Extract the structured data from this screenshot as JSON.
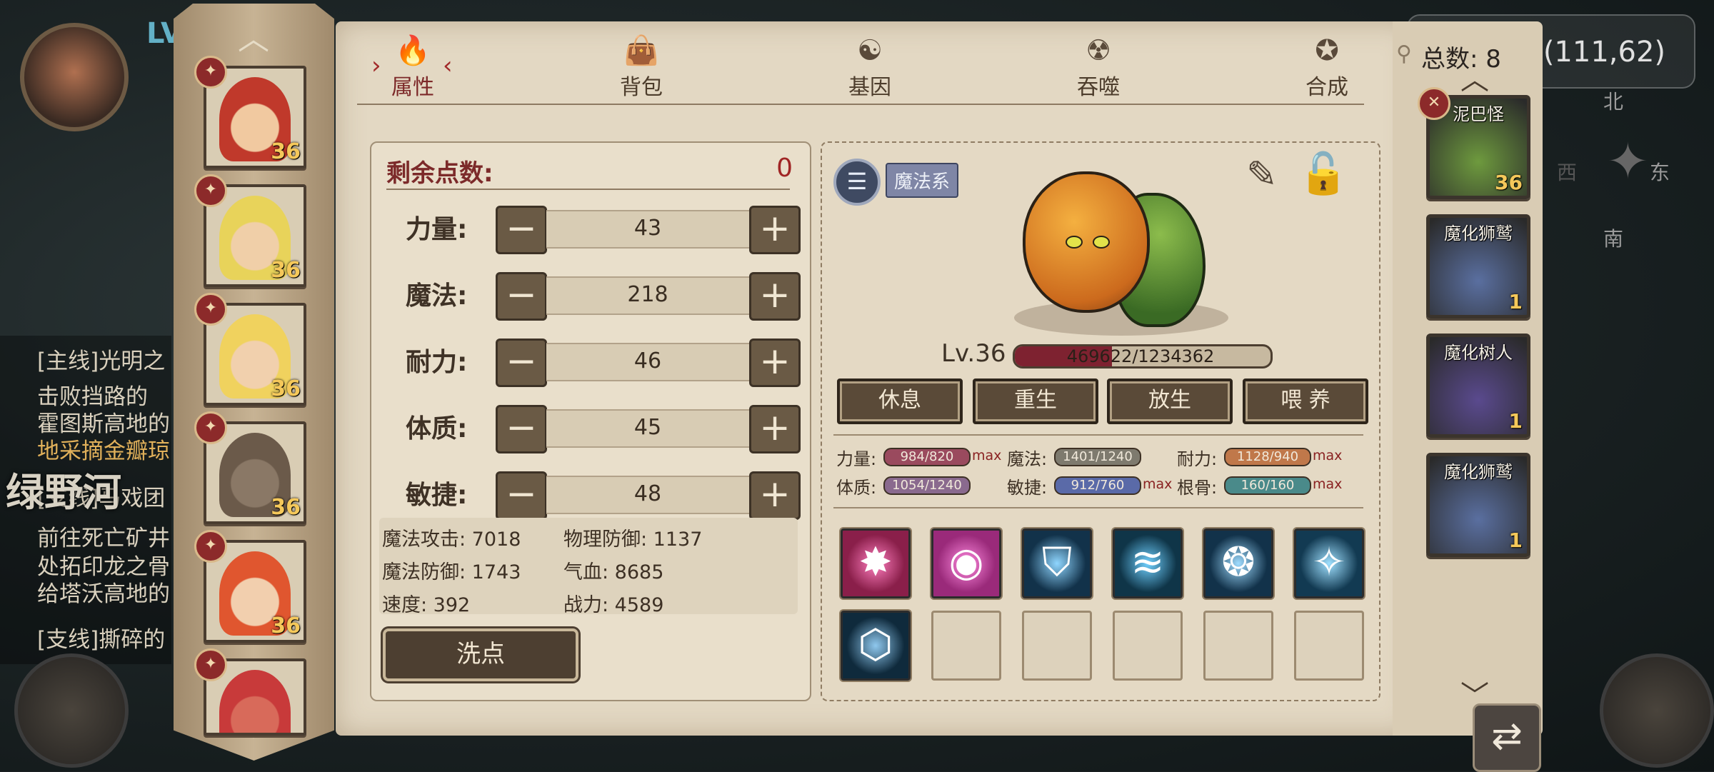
{
  "background": {
    "player_level": "LV",
    "coordinates": "(111,62)",
    "compass": {
      "north": "北",
      "south": "南",
      "west": "西",
      "east": "东"
    },
    "river_label": "绿野河",
    "quests": [
      {
        "text": "[主线]光明之",
        "highlight": false
      },
      {
        "text": "击败挡路的",
        "highlight": false
      },
      {
        "text": "霍图斯高地的",
        "highlight": false
      },
      {
        "text": "地采摘金瓣琼",
        "highlight": true
      },
      {
        "text": "[支线]马戏团",
        "highlight": false
      },
      {
        "text": "前往死亡矿井",
        "highlight": false
      },
      {
        "text": "处拓印龙之骨",
        "highlight": false
      },
      {
        "text": "给塔沃高地的",
        "highlight": false
      },
      {
        "text": "[支线]撕碎的",
        "highlight": false
      }
    ]
  },
  "characters": [
    {
      "level": "36",
      "hair": "#c0392b",
      "skin": "#f1c9a0"
    },
    {
      "level": "36",
      "hair": "#e8d35a",
      "skin": "#f0cfa8"
    },
    {
      "level": "36",
      "hair": "#f0d25e",
      "skin": "#f1d0ad"
    },
    {
      "level": "36",
      "hair": "#6b5a4a",
      "skin": "#8a7866"
    },
    {
      "level": "36",
      "hair": "#e0562f",
      "skin": "#f2cfae"
    },
    {
      "level": "",
      "hair": "#c83a3a",
      "skin": "#d86a5a"
    }
  ],
  "tabs": [
    {
      "label": "属性",
      "icon": "fire-icon",
      "glyph": "🔥",
      "active": true
    },
    {
      "label": "背包",
      "icon": "bag-icon",
      "glyph": "👜",
      "active": false
    },
    {
      "label": "基因",
      "icon": "gene-icon",
      "glyph": "☯",
      "active": false
    },
    {
      "label": "吞噬",
      "icon": "devour-icon",
      "glyph": "☢",
      "active": false
    },
    {
      "label": "合成",
      "icon": "synth-icon",
      "glyph": "✪",
      "active": false
    }
  ],
  "stats": {
    "remain_label": "剩余点数:",
    "remain_value": "0",
    "rows": [
      {
        "label": "力量:",
        "value": "43"
      },
      {
        "label": "魔法:",
        "value": "218"
      },
      {
        "label": "耐力:",
        "value": "46"
      },
      {
        "label": "体质:",
        "value": "45"
      },
      {
        "label": "敏捷:",
        "value": "48"
      }
    ],
    "minus": "−",
    "plus": "+",
    "derived": [
      {
        "text": "魔法攻击: 7018"
      },
      {
        "text": "物理防御: 1137"
      },
      {
        "text": "魔法防御: 1743"
      },
      {
        "text": "气血: 8685"
      },
      {
        "text": "速度: 392"
      },
      {
        "text": "战力: 4589"
      }
    ],
    "reset_label": "洗点"
  },
  "pet": {
    "type_tag": "魔法系",
    "level": "Lv.36",
    "hp_text": "469622/1234362",
    "hp_fraction": 0.38,
    "actions": [
      "休息",
      "重生",
      "放生",
      "喂 养"
    ],
    "attributes": [
      {
        "label": "力量:",
        "value": "984/820",
        "color": "#9a4a5e",
        "max": "max"
      },
      {
        "label": "魔法:",
        "value": "1401/1240",
        "color": "#7e7a6e",
        "max": ""
      },
      {
        "label": "耐力:",
        "value": "1128/940",
        "color": "#c0784a",
        "max": "max"
      },
      {
        "label": "体质:",
        "value": "1054/1240",
        "color": "#8a6a8e",
        "max": ""
      },
      {
        "label": "敏捷:",
        "value": "912/760",
        "color": "#5a6aa8",
        "max": "max"
      },
      {
        "label": "根骨:",
        "value": "160/160",
        "color": "#4a8a8a",
        "max": "max"
      }
    ],
    "skills": [
      {
        "icon": "burst-skill-icon",
        "bg": "#8a1f4a",
        "fg": "#ff7fc0",
        "glyph": "✸"
      },
      {
        "icon": "orb-skill-icon",
        "bg": "#9a2a7a",
        "fg": "#ff8ae0",
        "glyph": "◉"
      },
      {
        "icon": "shield-skill-icon",
        "bg": "#12324a",
        "fg": "#8fd6ff",
        "glyph": "⛉"
      },
      {
        "icon": "claw-skill-icon",
        "bg": "#0f3548",
        "fg": "#6fd0ff",
        "glyph": "≋"
      },
      {
        "icon": "vortex-skill-icon",
        "bg": "#12324a",
        "fg": "#9fdcff",
        "glyph": "❂"
      },
      {
        "icon": "shatter-skill-icon",
        "bg": "#123a52",
        "fg": "#9fe0ff",
        "glyph": "✧"
      },
      {
        "icon": "hex-skill-icon",
        "bg": "#0f2a3c",
        "fg": "#8fc8ee",
        "glyph": "⬡"
      }
    ],
    "empty_slots": 5
  },
  "pet_list": {
    "total_label": "总数: 8",
    "items": [
      {
        "name": "泥巴怪",
        "count": "36",
        "bg": "#6e9a3e"
      },
      {
        "name": "魔化狮鹫",
        "count": "1",
        "bg": "#5a6fa0"
      },
      {
        "name": "魔化树人",
        "count": "1",
        "bg": "#5a4a8e"
      },
      {
        "name": "魔化狮鹫",
        "count": "1",
        "bg": "#5a6fa0"
      }
    ]
  }
}
